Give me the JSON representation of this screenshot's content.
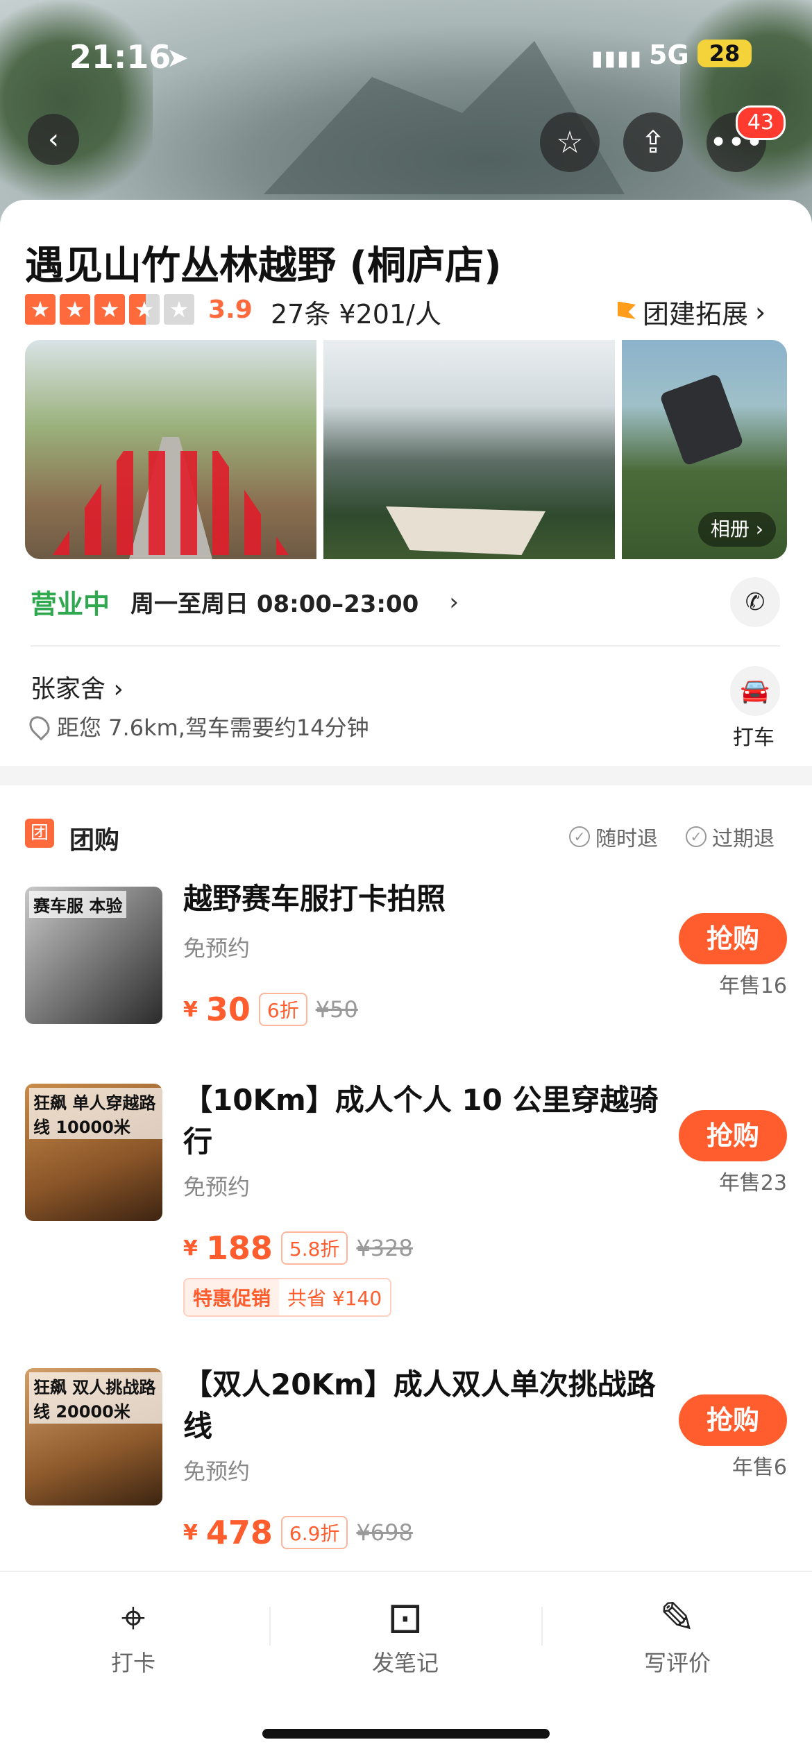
{
  "status_bar": {
    "time": "21:16",
    "network": "5G",
    "battery": "28"
  },
  "header": {
    "notification_count": "43"
  },
  "shop": {
    "name": "遇见山竹丛林越野 (桐庐店)",
    "rating": "3.9",
    "rating_value": 3.5,
    "reviews_price": "27条 ¥201/人",
    "category_link": "团建拓展"
  },
  "photos": {
    "album_label": "相册"
  },
  "hours": {
    "status": "营业中",
    "time": "周一至周日 08:00–23:00"
  },
  "location": {
    "area": "张家舍",
    "distance": "距您 7.6km,驾车需要约14分钟",
    "taxi_label": "打车"
  },
  "group_buy": {
    "title": "团购",
    "icon_text": "团",
    "policies": [
      "随时退",
      "过期退"
    ],
    "deals": [
      {
        "thumb_text": "赛车服 本验",
        "title": "越野赛车服打卡拍照",
        "subtitle": "免预约",
        "buy_label": "抢购",
        "sales": "年售16",
        "price": "30",
        "discount": "6折",
        "original": "¥50"
      },
      {
        "thumb_text": "狂飙 单人穿越路线 10000米",
        "title": "【10Km】成人个人 10 公里穿越骑行",
        "subtitle": "免预约",
        "buy_label": "抢购",
        "sales": "年售23",
        "price": "188",
        "discount": "5.8折",
        "original": "¥328",
        "promo_tag": "特惠促销",
        "promo_text": "共省 ¥140"
      },
      {
        "thumb_text": "狂飙 双人挑战路线 20000米",
        "title": "【双人20Km】成人双人单次挑战路线",
        "subtitle": "免预约",
        "buy_label": "抢购",
        "sales": "年售6",
        "price": "478",
        "discount": "6.9折",
        "original": "¥698"
      }
    ]
  },
  "tabbar": {
    "items": [
      "打卡",
      "发笔记",
      "写评价"
    ]
  },
  "colors": {
    "accent": "#ff5d2e",
    "open_green": "#2fa84f",
    "star": "#ff6a3d"
  }
}
